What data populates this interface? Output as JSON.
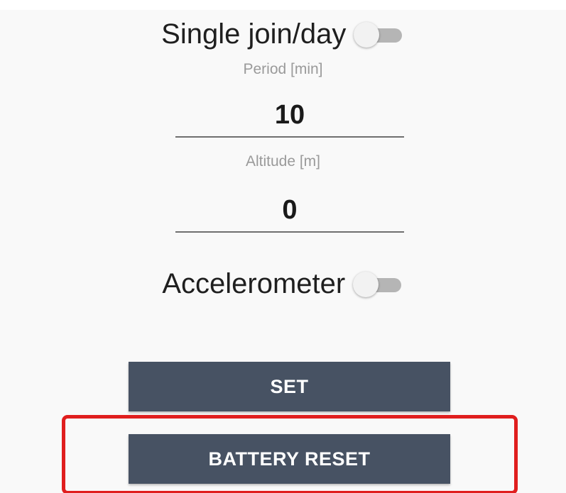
{
  "settings": {
    "single_join": {
      "label": "Single join/day",
      "enabled": false
    },
    "period": {
      "label": "Period [min]",
      "value": "10"
    },
    "altitude": {
      "label": "Altitude [m]",
      "value": "0"
    },
    "accelerometer": {
      "label": "Accelerometer",
      "enabled": false
    }
  },
  "buttons": {
    "set_label": "SET",
    "battery_reset_label": "BATTERY RESET"
  },
  "colors": {
    "button_bg": "#475263",
    "highlight_border": "#e01e1e",
    "switch_track_off": "#b5b5b5"
  },
  "icons": {
    "single_join_toggle": "toggle-switch-off-icon",
    "accelerometer_toggle": "toggle-switch-off-icon"
  }
}
